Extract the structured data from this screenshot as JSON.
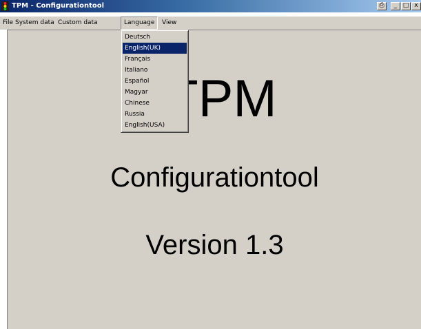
{
  "window": {
    "title": "TPM - Configurationtool",
    "controls": {
      "extra": "⎙",
      "minimize": "_",
      "maximize": "□",
      "close": "x"
    }
  },
  "menubar": {
    "items": [
      "File",
      "System data",
      "Custom data",
      "Language",
      "View"
    ],
    "open_menu": "Language"
  },
  "language_menu": {
    "options": [
      "Deutsch",
      "English(UK)",
      "Français",
      "Italiano",
      "Español",
      "Magyar",
      "Chinese",
      "Russia",
      "English(USA)"
    ],
    "selected": "English(UK)"
  },
  "content": {
    "title": "TPM",
    "subtitle": "Configurationtool",
    "version": "Version 1.3"
  },
  "colors": {
    "titlebar_start": "#0a246a",
    "titlebar_end": "#a6caf0",
    "face": "#d4d0c8",
    "highlight": "#0a246a"
  }
}
